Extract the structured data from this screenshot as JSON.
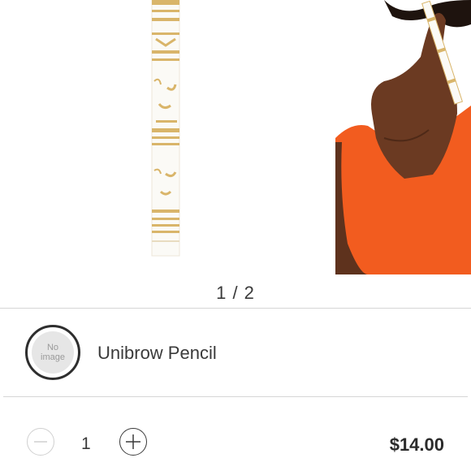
{
  "gallery": {
    "current_page": "1",
    "page_separator": " / ",
    "total_pages": "2"
  },
  "product": {
    "name": "Unibrow Pencil",
    "thumbnail_placeholder_line1": "No",
    "thumbnail_placeholder_line2": "image"
  },
  "cart": {
    "quantity": "1",
    "price": "$14.00"
  },
  "colors": {
    "pencil_gold": "#d9b56a",
    "dress_orange": "#f25c1f",
    "skin": "#6b3a22"
  }
}
